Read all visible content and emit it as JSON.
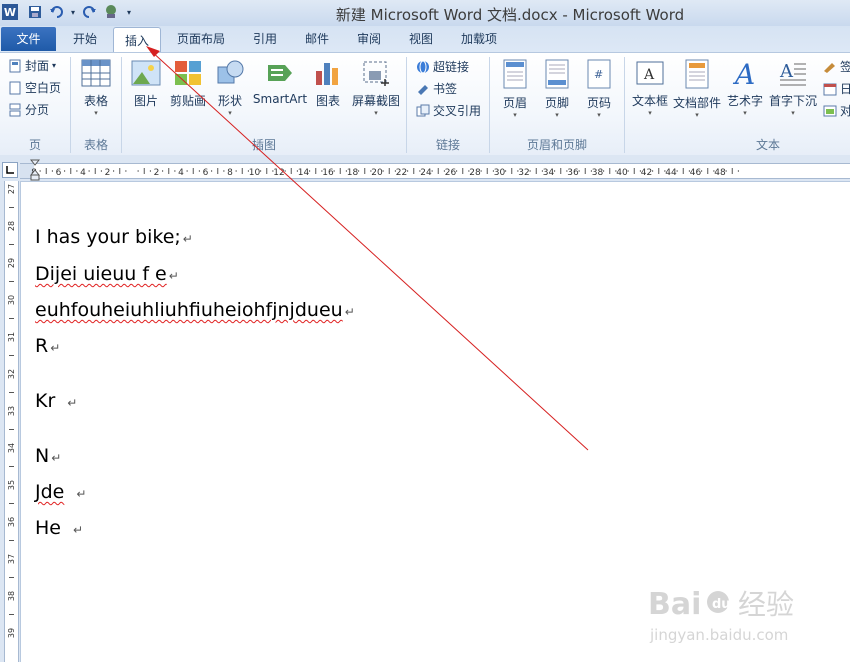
{
  "window": {
    "title": "新建 Microsoft Word 文档.docx - Microsoft Word"
  },
  "tabs": [
    {
      "label": "文件",
      "id": "file"
    },
    {
      "label": "开始",
      "id": "home"
    },
    {
      "label": "插入",
      "id": "insert"
    },
    {
      "label": "页面布局",
      "id": "page-layout"
    },
    {
      "label": "引用",
      "id": "references"
    },
    {
      "label": "邮件",
      "id": "mailings"
    },
    {
      "label": "审阅",
      "id": "review"
    },
    {
      "label": "视图",
      "id": "view"
    },
    {
      "label": "加载项",
      "id": "addins"
    }
  ],
  "ribbon": {
    "pages": {
      "label": "页",
      "cover": "封面",
      "blank": "空白页",
      "break": "分页"
    },
    "tables": {
      "label": "表格",
      "table": "表格"
    },
    "illustrations": {
      "label": "插图",
      "picture": "图片",
      "clipart": "剪贴画",
      "shapes": "形状",
      "smartart": "SmartArt",
      "chart": "图表",
      "screenshot": "屏幕截图"
    },
    "links": {
      "label": "链接",
      "hyperlink": "超链接",
      "bookmark": "书签",
      "crossref": "交叉引用"
    },
    "header_footer": {
      "label": "页眉和页脚",
      "header": "页眉",
      "footer": "页脚",
      "pagenum": "页码"
    },
    "text": {
      "label": "文本",
      "textbox": "文本框",
      "quickparts": "文档部件",
      "wordart": "艺术字",
      "dropcap": "首字下沉",
      "sig": "签",
      "date": "日",
      "obj": "对"
    }
  },
  "ruler": {
    "h_numbers": [
      "8",
      "6",
      "4",
      "2",
      "",
      "2",
      "4",
      "6",
      "8",
      "10",
      "12",
      "14",
      "16",
      "18",
      "20",
      "22",
      "24",
      "26",
      "28",
      "30",
      "32",
      "34",
      "36",
      "38",
      "40",
      "42",
      "44",
      "46",
      "48"
    ],
    "v_numbers": [
      "27",
      "",
      "28",
      "",
      "29",
      "",
      "30",
      "",
      "31",
      "",
      "32",
      "",
      "33",
      "",
      "34",
      "",
      "35",
      "",
      "36",
      "",
      "37",
      "",
      "38",
      "",
      "39"
    ]
  },
  "document": {
    "lines": [
      "I has your bike;",
      "Dijei uieuu f e",
      "euhfouheiuhliuhfiuheiohfjnjdueu",
      "R",
      "Kr",
      "N",
      "Jde",
      "He"
    ]
  },
  "watermark": {
    "brand": "Baidu",
    "cn": "经验",
    "url": "jingyan.baidu.com"
  }
}
